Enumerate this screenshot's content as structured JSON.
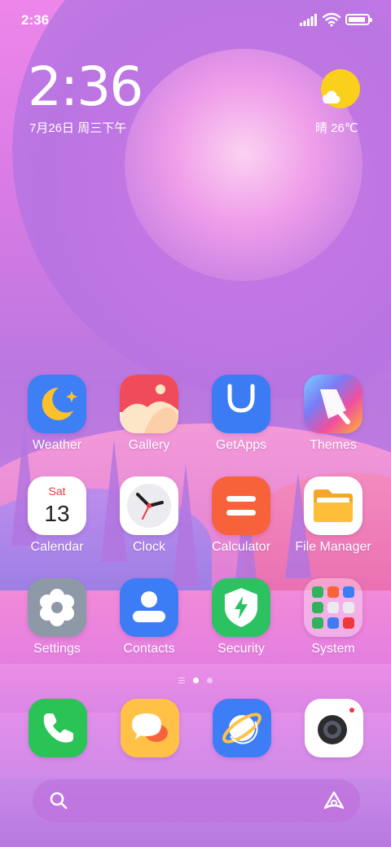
{
  "status_bar": {
    "time": "2:36",
    "battery_level": 0.9,
    "signal_icon": "signal-bars-icon",
    "wifi_icon": "wifi-icon",
    "battery_icon": "battery-icon"
  },
  "clock_widget": {
    "time": "2:36",
    "date": "7月26日 周三下午"
  },
  "weather_widget": {
    "icon": "sun-cloud-icon",
    "text": "晴 26℃"
  },
  "apps": {
    "weather": "Weather",
    "gallery": "Gallery",
    "getapps": "GetApps",
    "themes": "Themes",
    "calendar": "Calendar",
    "calendar_day": "Sat",
    "calendar_date": "13",
    "clock": "Clock",
    "calculator": "Calculator",
    "file_manager": "File Manager",
    "settings": "Settings",
    "contacts": "Contacts",
    "security": "Security",
    "system": "System"
  },
  "pager": {
    "pages": 2,
    "active_index": 0
  },
  "dock": {
    "items": [
      "phone-icon",
      "messaging-icon",
      "browser-icon",
      "camera-icon"
    ]
  },
  "search_bar": {
    "search_icon": "search-icon",
    "assistant_icon": "assistant-icon"
  },
  "colors": {
    "weather_bg": "#3d7ff5",
    "getapps_bg": "#3b7cf4",
    "calculator_bg": "#f7623a",
    "settings_bg": "#8e99a8",
    "contacts_bg": "#3c7df5",
    "security_bg": "#2cc262",
    "phone_bg": "#2ac456",
    "messaging_bg": "#ffc247",
    "browser_bg": "#3d7df5"
  }
}
